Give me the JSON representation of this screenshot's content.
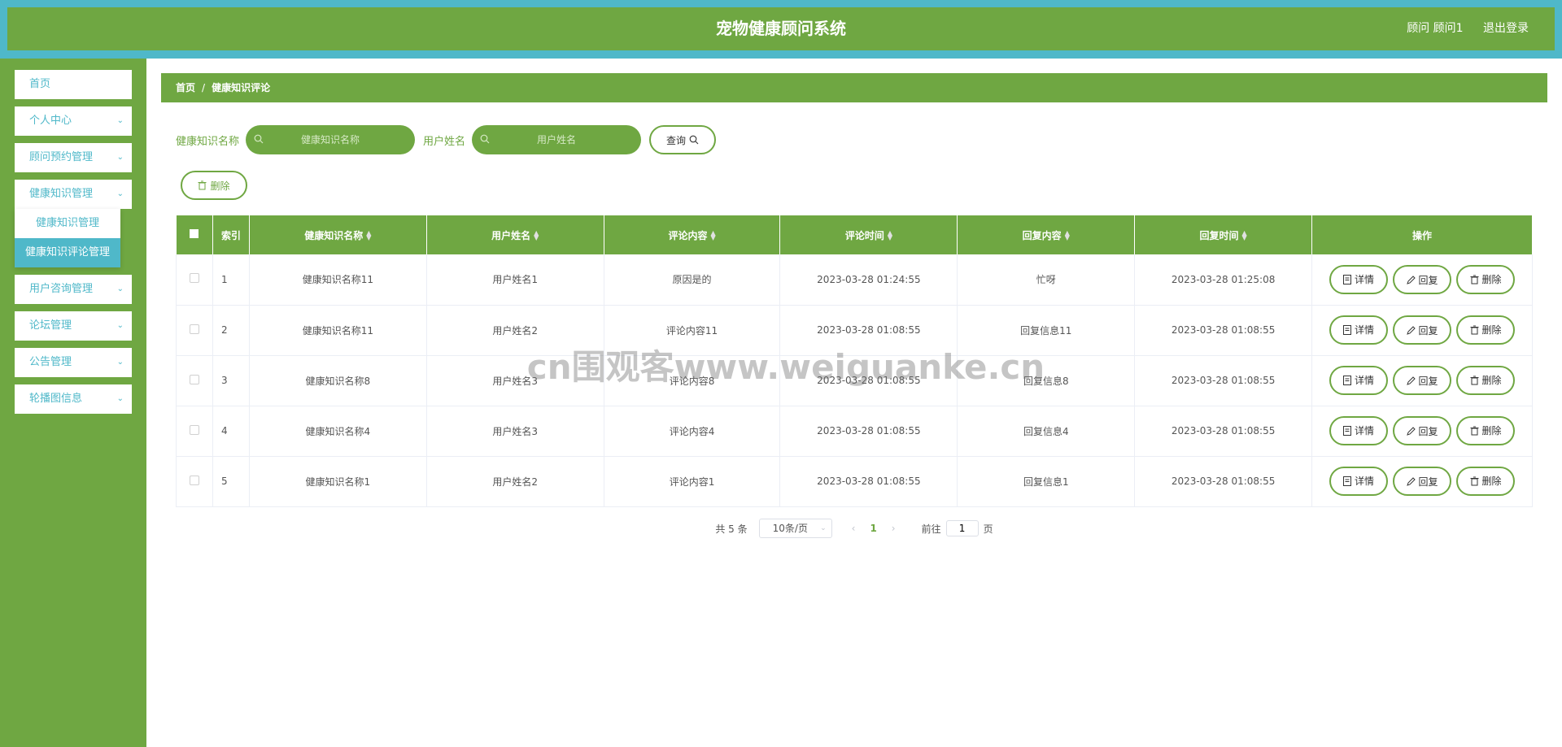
{
  "header": {
    "title": "宠物健康顾问系统",
    "user_label": "顾问 顾问1",
    "logout_label": "退出登录"
  },
  "sidebar": {
    "items": [
      {
        "label": "首页",
        "has_children": false
      },
      {
        "label": "个人中心",
        "has_children": true
      },
      {
        "label": "顾问预约管理",
        "has_children": true
      },
      {
        "label": "健康知识管理",
        "has_children": true
      },
      {
        "label": "用户咨询管理",
        "has_children": true
      },
      {
        "label": "论坛管理",
        "has_children": true
      },
      {
        "label": "公告管理",
        "has_children": true
      },
      {
        "label": "轮播图信息",
        "has_children": true
      }
    ],
    "submenu": [
      {
        "label": "健康知识管理",
        "active": false
      },
      {
        "label": "健康知识评论管理",
        "active": true
      }
    ]
  },
  "breadcrumb": {
    "home": "首页",
    "separator": "/",
    "current": "健康知识评论"
  },
  "search": {
    "field1_label": "健康知识名称",
    "field1_placeholder": "健康知识名称",
    "field2_label": "用户姓名",
    "field2_placeholder": "用户姓名",
    "query_label": "查询"
  },
  "actions": {
    "delete_label": "删除"
  },
  "table": {
    "columns": [
      "索引",
      "健康知识名称",
      "用户姓名",
      "评论内容",
      "评论时间",
      "回复内容",
      "回复时间",
      "操作"
    ],
    "rows": [
      [
        "1",
        "健康知识名称11",
        "用户姓名1",
        "原因是的",
        "2023-03-28 01:24:55",
        "忙呀",
        "2023-03-28 01:25:08"
      ],
      [
        "2",
        "健康知识名称11",
        "用户姓名2",
        "评论内容11",
        "2023-03-28 01:08:55",
        "回复信息11",
        "2023-03-28 01:08:55"
      ],
      [
        "3",
        "健康知识名称8",
        "用户姓名3",
        "评论内容8",
        "2023-03-28 01:08:55",
        "回复信息8",
        "2023-03-28 01:08:55"
      ],
      [
        "4",
        "健康知识名称4",
        "用户姓名3",
        "评论内容4",
        "2023-03-28 01:08:55",
        "回复信息4",
        "2023-03-28 01:08:55"
      ],
      [
        "5",
        "健康知识名称1",
        "用户姓名2",
        "评论内容1",
        "2023-03-28 01:08:55",
        "回复信息1",
        "2023-03-28 01:08:55"
      ]
    ],
    "row_actions": [
      "详情",
      "回复",
      "删除"
    ]
  },
  "pagination": {
    "total_text": "共 5 条",
    "page_size": "10条/页",
    "current_page": "1",
    "goto_prefix": "前往",
    "goto_value": "1",
    "goto_suffix": "页"
  },
  "watermark": "cn围观客www.weiguanke.cn",
  "colors": {
    "primary_green": "#6fa742",
    "accent_teal": "#4fb8c9"
  }
}
